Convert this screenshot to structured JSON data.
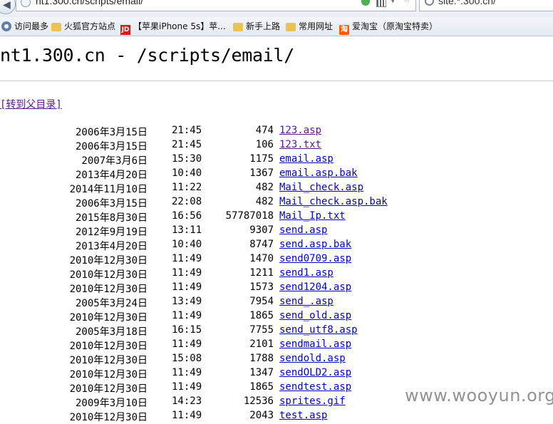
{
  "browser": {
    "url": "nt1.300.cn/scripts/email/",
    "search_query": "site:*.300.cn/"
  },
  "bookmarks": [
    {
      "label": "访问最多",
      "icon": "gear-icon"
    },
    {
      "label": "火狐官方站点",
      "icon": "folder-icon"
    },
    {
      "label": "【苹果iPhone 5s】苹...",
      "icon": "jd-icon",
      "icon_text": "JD"
    },
    {
      "label": "新手上路",
      "icon": "folder-icon"
    },
    {
      "label": "常用网址",
      "icon": "folder-icon"
    },
    {
      "label": "爱淘宝（原淘宝特卖）",
      "icon": "taobao-icon",
      "icon_text": "淘"
    }
  ],
  "page": {
    "heading": "nt1.300.cn - /scripts/email/",
    "parent_link": "[转到父目录]"
  },
  "files": [
    {
      "date": "2006年3月15日",
      "time": "21:45",
      "size": "474",
      "name": "123.asp",
      "visited": true
    },
    {
      "date": "2006年3月15日",
      "time": "21:45",
      "size": "106",
      "name": "123.txt",
      "visited": true
    },
    {
      "date": "2007年3月6日",
      "time": "15:30",
      "size": "1175",
      "name": "email.asp",
      "visited": false
    },
    {
      "date": "2013年4月20日",
      "time": "10:40",
      "size": "1367",
      "name": "email.asp.bak",
      "visited": false
    },
    {
      "date": "2014年11月10日",
      "time": "11:22",
      "size": "482",
      "name": "Mail_check.asp",
      "visited": false
    },
    {
      "date": "2006年3月15日",
      "time": "22:08",
      "size": "482",
      "name": "Mail_check.asp.bak",
      "visited": false
    },
    {
      "date": "2015年8月30日",
      "time": "16:56",
      "size": "57787018",
      "name": "Mail_Ip.txt",
      "visited": false
    },
    {
      "date": "2012年9月19日",
      "time": "13:11",
      "size": "9307",
      "name": "send.asp",
      "visited": false
    },
    {
      "date": "2013年4月20日",
      "time": "10:40",
      "size": "8747",
      "name": "send.asp.bak",
      "visited": false
    },
    {
      "date": "2010年12月30日",
      "time": "11:49",
      "size": "1470",
      "name": "send0709.asp",
      "visited": false
    },
    {
      "date": "2010年12月30日",
      "time": "11:49",
      "size": "1211",
      "name": "send1.asp",
      "visited": false
    },
    {
      "date": "2010年12月30日",
      "time": "11:49",
      "size": "1573",
      "name": "send1204.asp",
      "visited": false
    },
    {
      "date": "2005年3月24日",
      "time": "13:49",
      "size": "7954",
      "name": "send_.asp",
      "visited": false
    },
    {
      "date": "2010年12月30日",
      "time": "11:49",
      "size": "1865",
      "name": "send_old.asp",
      "visited": false
    },
    {
      "date": "2005年3月18日",
      "time": "16:15",
      "size": "7755",
      "name": "send_utf8.asp",
      "visited": false
    },
    {
      "date": "2010年12月30日",
      "time": "11:49",
      "size": "2101",
      "name": "sendmail.asp",
      "visited": false
    },
    {
      "date": "2010年12月30日",
      "time": "15:08",
      "size": "1788",
      "name": "sendold.asp",
      "visited": false
    },
    {
      "date": "2010年12月30日",
      "time": "11:49",
      "size": "1347",
      "name": "sendOLD2.asp",
      "visited": false
    },
    {
      "date": "2010年12月30日",
      "time": "11:49",
      "size": "1865",
      "name": "sendtest.asp",
      "visited": false
    },
    {
      "date": "2009年3月10日",
      "time": "14:23",
      "size": "12536",
      "name": "sprites.gif",
      "visited": false
    },
    {
      "date": "2010年12月30日",
      "time": "11:49",
      "size": "2043",
      "name": "test.asp",
      "visited": false
    }
  ],
  "watermark": "www.wooyun.org"
}
